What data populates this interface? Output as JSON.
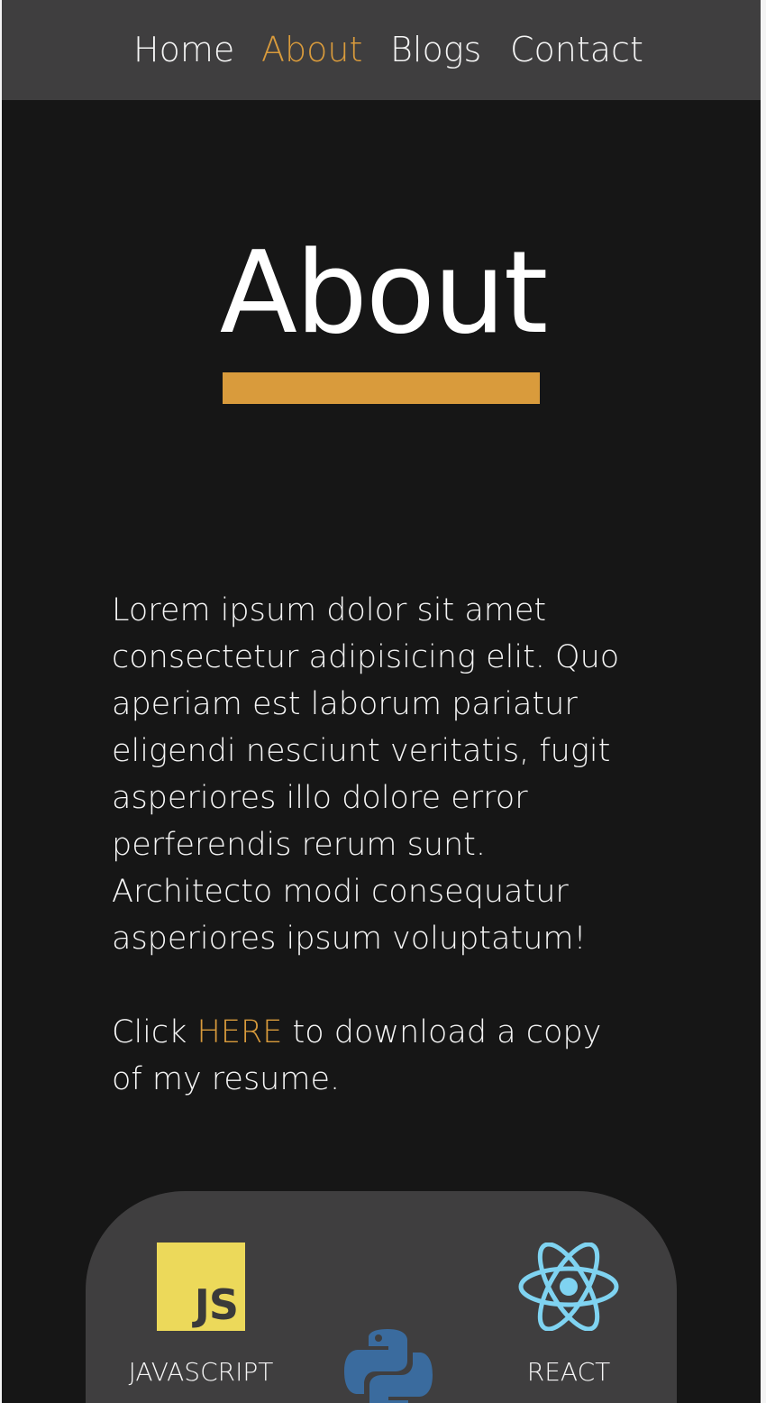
{
  "nav": {
    "items": [
      {
        "label": "Home",
        "active": false
      },
      {
        "label": "About",
        "active": true
      },
      {
        "label": "Blogs",
        "active": false
      },
      {
        "label": "Contact",
        "active": false
      }
    ]
  },
  "page": {
    "title": "About"
  },
  "about": {
    "paragraph": "Lorem ipsum dolor sit amet consectetur adipisicing elit. Quo aperiam est laborum pariatur eligendi nesciunt veritatis, fugit asperiores illo dolore error perferendis rerum sunt. Architecto modi consequatur asperiores ipsum voluptatum!",
    "resume_prefix": "Click ",
    "resume_link": "HERE",
    "resume_suffix": " to download a copy of my resume."
  },
  "skills": {
    "javascript": {
      "label": "JAVASCRIPT",
      "icon": "javascript-icon",
      "badge_text": "JS"
    },
    "python": {
      "icon": "python-icon"
    },
    "react": {
      "label": "REACT",
      "icon": "react-icon"
    }
  },
  "colors": {
    "accent": "#d99b3c",
    "background": "#161616",
    "panel": "#3f3e3f",
    "js_yellow": "#ecd95a",
    "react_blue": "#7fd3f1",
    "python_blue": "#3a6b9e"
  }
}
